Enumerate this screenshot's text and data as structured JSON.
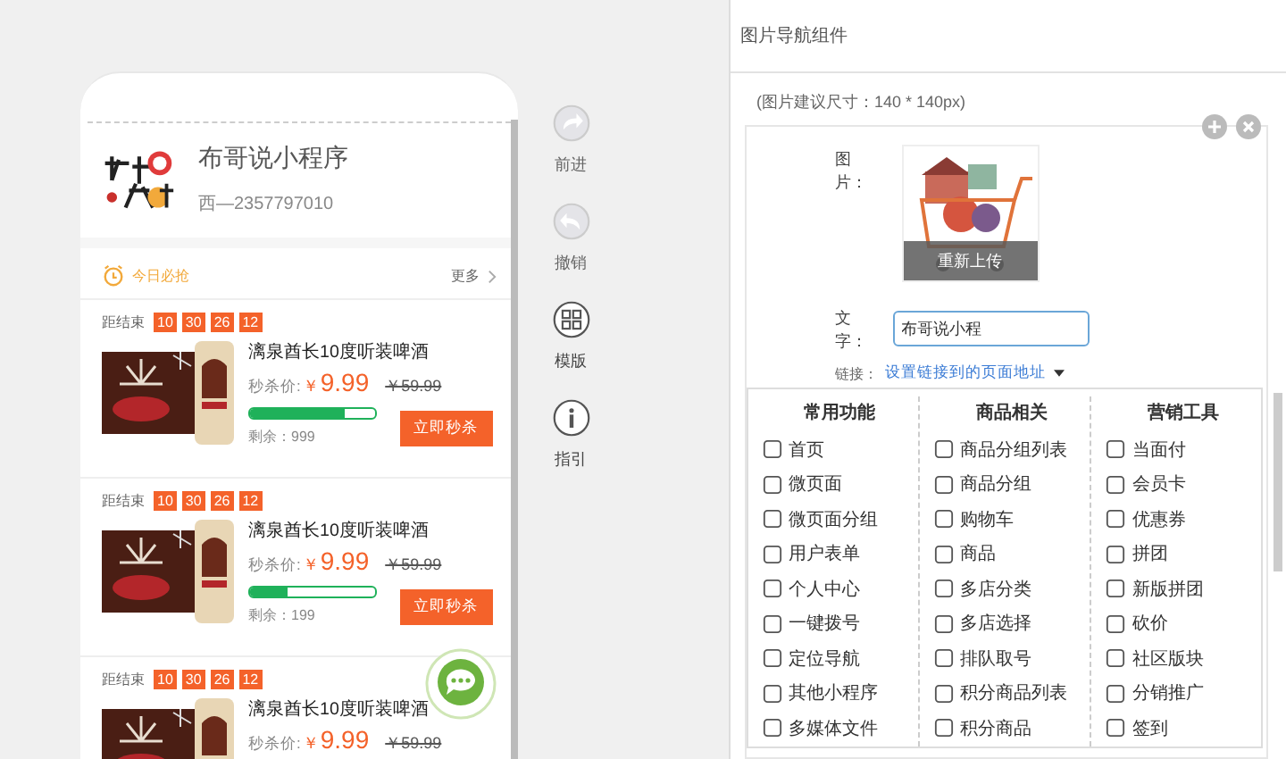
{
  "phone": {
    "store": {
      "name": "布哥说小程序",
      "subtitle": "西—2357797010"
    },
    "section": {
      "title": "今日必抢",
      "more": "更多"
    },
    "products": [
      {
        "countdown_label": "距结束",
        "countdown": [
          "10",
          "30",
          "26",
          "12"
        ],
        "name": "漓泉酋长10度听装啤酒",
        "price_label": "秒杀价:",
        "currency": "￥",
        "price": "9.99",
        "original_price": "￥59.99",
        "level": 0.75,
        "stock": "剩余：999",
        "button": "立即秒杀"
      },
      {
        "countdown_label": "距结束",
        "countdown": [
          "10",
          "30",
          "26",
          "12"
        ],
        "name": "漓泉酋长10度听装啤酒",
        "price_label": "秒杀价:",
        "currency": "￥",
        "price": "9.99",
        "original_price": "￥59.99",
        "level": 0.3,
        "stock": "剩余：199",
        "button": "立即秒杀"
      },
      {
        "countdown_label": "距结束",
        "countdown": [
          "10",
          "30",
          "26",
          "12"
        ],
        "name": "漓泉酋长10度听装啤酒",
        "price_label": "秒杀价:",
        "currency": "￥",
        "price": "9.99",
        "original_price": "￥59.99"
      }
    ]
  },
  "toolbar": [
    {
      "kind": "redo",
      "label": "前进",
      "disabled": true
    },
    {
      "kind": "undo",
      "label": "撤销",
      "disabled": true
    },
    {
      "kind": "template",
      "label": "模版",
      "disabled": false
    },
    {
      "kind": "guide",
      "label": "指引",
      "disabled": false
    }
  ],
  "editor": {
    "title": "图片导航组件",
    "hint": "(图片建议尺寸：140 * 140px)",
    "image_label": "图片：",
    "reupload": "重新上传",
    "text_label": "文字：",
    "text_value": "布哥说小程",
    "link_label": "链接：",
    "link": "设置链接到的页面地址",
    "menu": [
      {
        "title": "常用功能",
        "items": [
          "首页",
          "微页面",
          "微页面分组",
          "用户表单",
          "个人中心",
          "一键拨号",
          "定位导航",
          "其他小程序",
          "多媒体文件"
        ]
      },
      {
        "title": "商品相关",
        "items": [
          "商品分组列表",
          "商品分组",
          "购物车",
          "商品",
          "多店分类",
          "多店选择",
          "排队取号",
          "积分商品列表",
          "积分商品"
        ]
      },
      {
        "title": "营销工具",
        "items": [
          "当面付",
          "会员卡",
          "优惠券",
          "拼团",
          "新版拼团",
          "砍价",
          "社区版块",
          "分销推广",
          "签到"
        ]
      }
    ]
  }
}
